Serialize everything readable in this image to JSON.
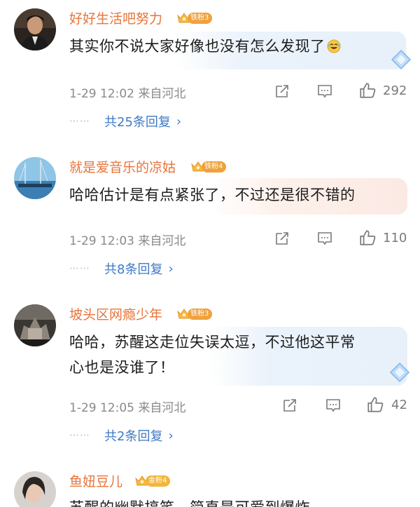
{
  "comments": [
    {
      "username": "好好生活吧努力",
      "badge": "铁粉3",
      "text": "其实你不说大家好像也没有怎么发现了",
      "emoji": "laughing-emoji",
      "time": "1-29 12:02",
      "location": "来自河北",
      "likes": "292",
      "replies": "共25条回复"
    },
    {
      "username": "就是爱音乐的凉姑",
      "badge": "铁粉4",
      "text": "哈哈估计是有点紧张了，不过还是很不错的",
      "time": "1-29 12:03",
      "location": "来自河北",
      "likes": "110",
      "replies": "共8条回复"
    },
    {
      "username": "坡头区网瘾少年",
      "badge": "铁粉3",
      "text_line1": "哈哈，苏醒这走位失误太逗，不过他这平常",
      "text_line2": "心也是没谁了！",
      "time": "1-29 12:05",
      "location": "来自河北",
      "likes": "42",
      "replies": "共2条回复"
    },
    {
      "username": "鱼妞豆儿",
      "badge": "金粉4",
      "text": "苏醒的幽默搞笑，简直是可爱到爆炸"
    }
  ],
  "icons": {
    "share": "share-icon",
    "comment": "comment-icon",
    "like": "thumbs-up-icon",
    "more": "ellipsis-dots",
    "chevron": "chevron-right-icon",
    "dots_text": "⋯⋯"
  },
  "colors": {
    "username": "#e8743a",
    "reply_link": "#3e79c7",
    "meta": "#8a8a8a"
  }
}
